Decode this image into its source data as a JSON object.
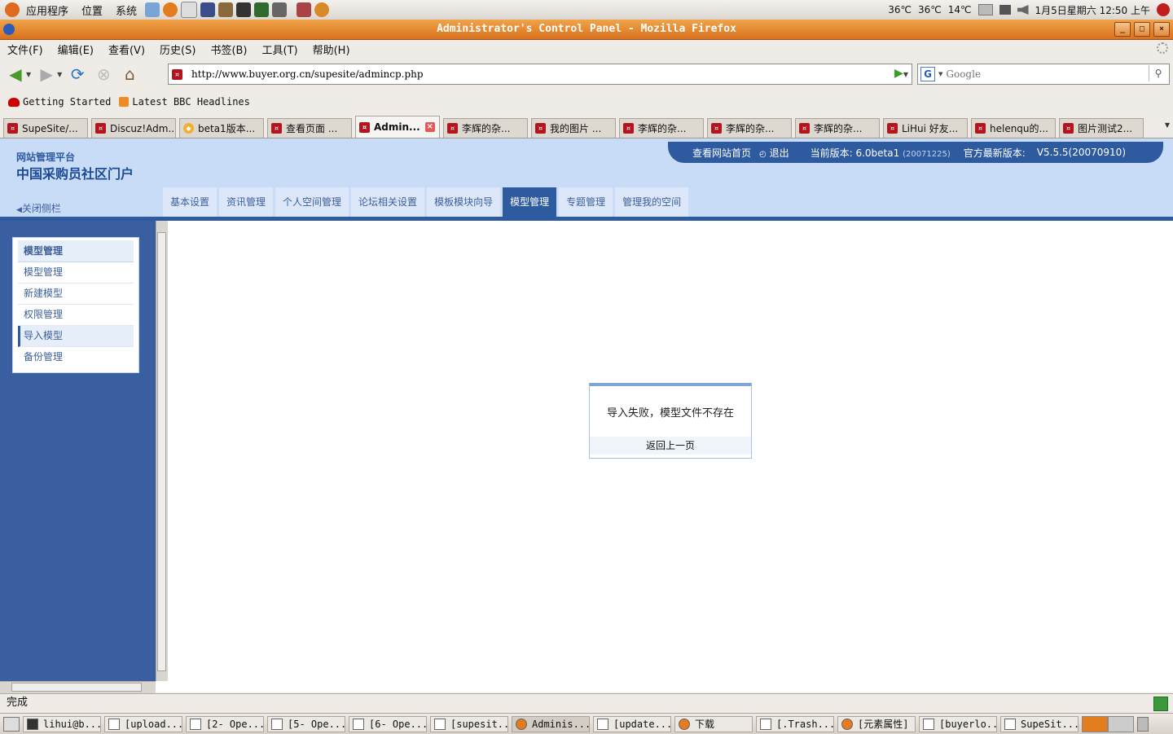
{
  "gnome_panel": {
    "menus": [
      "应用程序",
      "位置",
      "系统"
    ],
    "temps": [
      "36℃",
      "36℃",
      "14℃"
    ],
    "clock": "1月5日星期六 12:50 上午"
  },
  "window": {
    "title": "Administrator's Control Panel - Mozilla Firefox"
  },
  "menubar": [
    "文件(F)",
    "编辑(E)",
    "查看(V)",
    "历史(S)",
    "书签(B)",
    "工具(T)",
    "帮助(H)"
  ],
  "navbar": {
    "url": "http://www.buyer.org.cn/supesite/admincp.php",
    "search_placeholder": "Google"
  },
  "bookmarks": [
    "Getting Started",
    "Latest BBC Headlines"
  ],
  "tabs": [
    "SupeSite/...",
    "Discuz!Adm...",
    "beta1版本...",
    "查看页面 ...",
    "Admin...",
    "李辉的杂...",
    "我的图片 ...",
    "李辉的杂...",
    "李辉的杂...",
    "李辉的杂...",
    "LiHui 好友...",
    "helenqu的...",
    "图片测试2..."
  ],
  "active_tab_index": 4,
  "header": {
    "site_small": "网站管理平台",
    "site_big": "中国采购员社区门户",
    "close_sidebar": "关闭侧栏",
    "view_home": "查看网站首页",
    "logout": "退出",
    "current_version": "当前版本: 6.0beta1",
    "current_build": "(20071225)",
    "latest_label": "官方最新版本:",
    "latest_version": "V5.5.5(20070910)"
  },
  "cp_tabs": [
    "基本设置",
    "资讯管理",
    "个人空间管理",
    "论坛相关设置",
    "模板模块向导",
    "模型管理",
    "专题管理",
    "管理我的空间"
  ],
  "cp_tab_active_index": 5,
  "sidebar": {
    "title": "模型管理",
    "items": [
      "模型管理",
      "新建模型",
      "权限管理",
      "导入模型",
      "备份管理"
    ],
    "active_index": 3
  },
  "message": {
    "text": "导入失败，模型文件不存在",
    "back_link": "返回上一页"
  },
  "status": "完成",
  "taskbar": [
    "lihui@b...",
    "[upload...",
    "[2- Ope...",
    "[5- Ope...",
    "[6- Ope...",
    "[supesit...",
    "Adminis...",
    "[update...",
    "下载",
    "[.Trash...",
    "[元素属性]",
    "[buyerlo...",
    "SupeSit..."
  ],
  "taskbar_active_index": 6
}
